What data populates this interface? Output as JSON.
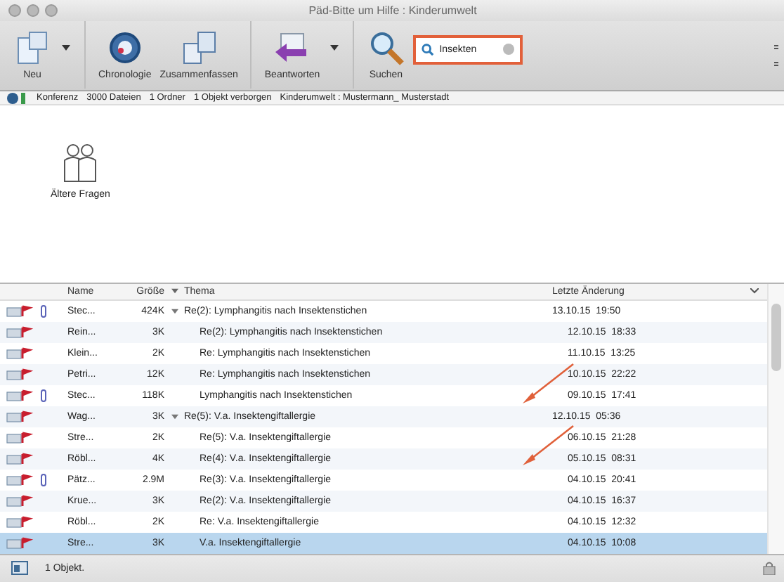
{
  "window": {
    "title": "Päd-Bitte um Hilfe : Kinderumwelt"
  },
  "toolbar": [
    {
      "kind": "split",
      "label": "Neu"
    },
    {
      "kind": "plain",
      "label": "Chronologie"
    },
    {
      "kind": "plain",
      "label": "Zusammenfassen"
    },
    {
      "kind": "split",
      "label": "Beantworten"
    },
    {
      "kind": "plain",
      "label": "Suchen"
    }
  ],
  "search": {
    "value": "Insekten"
  },
  "pathbar": {
    "items": [
      "Konferenz",
      "3000 Dateien",
      "1 Ordner",
      "1 Objekt verborgen",
      "Kinderumwelt : Mustermann_ Musterstadt"
    ]
  },
  "folders": [
    {
      "label": "Ältere Fragen"
    }
  ],
  "table": {
    "columns": [
      "Name",
      "Größe",
      "Thema",
      "Letzte Änderung"
    ],
    "threads": [
      {
        "attachment": true,
        "name": "Stec...",
        "size": "424K",
        "topic": "Re(2): Lymphangitis nach Insektenstichen",
        "date": "13.10.15  19:50",
        "expanded": true,
        "selected": false,
        "children": [
          {
            "attachment": false,
            "name": "Rein...",
            "size": "3K",
            "topic": "Re(2): Lymphangitis nach Insektenstichen",
            "date": "12.10.15  18:33",
            "selected": false
          },
          {
            "attachment": false,
            "name": "Klein...",
            "size": "2K",
            "topic": "Re: Lymphangitis nach Insektenstichen",
            "date": "11.10.15  13:25",
            "selected": false
          },
          {
            "attachment": false,
            "name": "Petri...",
            "size": "12K",
            "topic": "Re: Lymphangitis nach Insektenstichen",
            "date": "10.10.15  22:22",
            "selected": false
          },
          {
            "attachment": true,
            "name": "Stec...",
            "size": "118K",
            "topic": "Lymphangitis nach Insektenstichen",
            "date": "09.10.15  17:41",
            "selected": false
          }
        ]
      },
      {
        "attachment": false,
        "name": "Wag...",
        "size": "3K",
        "topic": "Re(5): V.a. Insektengiftallergie",
        "date": "12.10.15  05:36",
        "expanded": true,
        "selected": false,
        "children": [
          {
            "attachment": false,
            "name": "Stre...",
            "size": "2K",
            "topic": "Re(5): V.a. Insektengiftallergie",
            "date": "06.10.15  21:28",
            "selected": false
          },
          {
            "attachment": false,
            "name": "Röbl...",
            "size": "4K",
            "topic": "Re(4): V.a. Insektengiftallergie",
            "date": "05.10.15  08:31",
            "selected": false
          },
          {
            "attachment": true,
            "name": "Pätz...",
            "size": "2.9M",
            "topic": "Re(3): V.a. Insektengiftallergie",
            "date": "04.10.15  20:41",
            "selected": false
          },
          {
            "attachment": false,
            "name": "Krue...",
            "size": "3K",
            "topic": "Re(2): V.a. Insektengiftallergie",
            "date": "04.10.15  16:37",
            "selected": false
          },
          {
            "attachment": false,
            "name": "Röbl...",
            "size": "2K",
            "topic": "Re: V.a. Insektengiftallergie",
            "date": "04.10.15  12:32",
            "selected": false
          },
          {
            "attachment": false,
            "name": "Stre...",
            "size": "3K",
            "topic": "V.a. Insektengiftallergie",
            "date": "04.10.15  10:08",
            "selected": true
          }
        ]
      }
    ]
  },
  "status_bar": {
    "text": "1 Objekt."
  }
}
